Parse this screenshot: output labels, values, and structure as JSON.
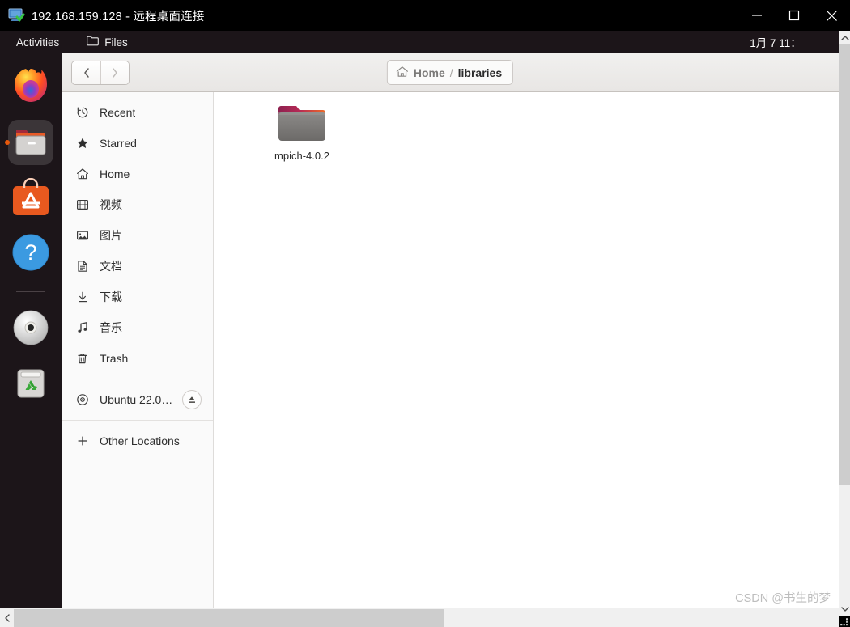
{
  "window": {
    "title": "192.168.159.128 - 远程桌面连接",
    "icon": "remote-desktop-icon",
    "controls": {
      "minimize": "minimize-icon",
      "maximize": "maximize-icon",
      "close": "close-icon"
    }
  },
  "topbar": {
    "activities": "Activities",
    "app_menu": "Files",
    "app_icon": "folder-icon",
    "clock": "1月 7  11："
  },
  "dock": {
    "items": [
      {
        "name": "firefox",
        "label": "Firefox",
        "active": false
      },
      {
        "name": "files",
        "label": "Files",
        "active": true
      },
      {
        "name": "ubuntu-software",
        "label": "Ubuntu Software",
        "active": false
      },
      {
        "name": "help",
        "label": "Help",
        "active": false
      },
      {
        "name": "disc",
        "label": "Ubuntu 22.0...",
        "active": false
      },
      {
        "name": "trash",
        "label": "Trash",
        "active": false
      }
    ]
  },
  "nautilus": {
    "nav": {
      "back": "back-icon",
      "forward": "forward-icon"
    },
    "breadcrumb": {
      "home_icon": "home-icon",
      "home": "Home",
      "separator": "/",
      "current": "libraries"
    },
    "sidebar": [
      {
        "icon": "clock-icon",
        "label": "Recent"
      },
      {
        "icon": "star-icon",
        "label": "Starred"
      },
      {
        "icon": "home-icon",
        "label": "Home"
      },
      {
        "icon": "video-icon",
        "label": "视频"
      },
      {
        "icon": "image-icon",
        "label": "图片"
      },
      {
        "icon": "document-icon",
        "label": "文档"
      },
      {
        "icon": "download-icon",
        "label": "下载"
      },
      {
        "icon": "music-icon",
        "label": "音乐"
      },
      {
        "icon": "trash-icon",
        "label": "Trash"
      }
    ],
    "volume": {
      "icon": "disc-icon",
      "label": "Ubuntu 22.0…",
      "eject": "eject-icon"
    },
    "other_locations": {
      "icon": "plus-icon",
      "label": "Other Locations"
    },
    "files": [
      {
        "icon": "folder-icon",
        "label": "mpich-4.0.2"
      }
    ]
  },
  "scrollbars": {
    "up": "chevron-up-icon",
    "down": "chevron-down-icon",
    "left": "chevron-left-icon"
  },
  "watermark": "CSDN @书生的梦",
  "colors": {
    "dock_bg": "#1c1519",
    "accent": "#e8590c",
    "headerbar": "#ebe9e7",
    "sidebar": "#fafafa"
  }
}
